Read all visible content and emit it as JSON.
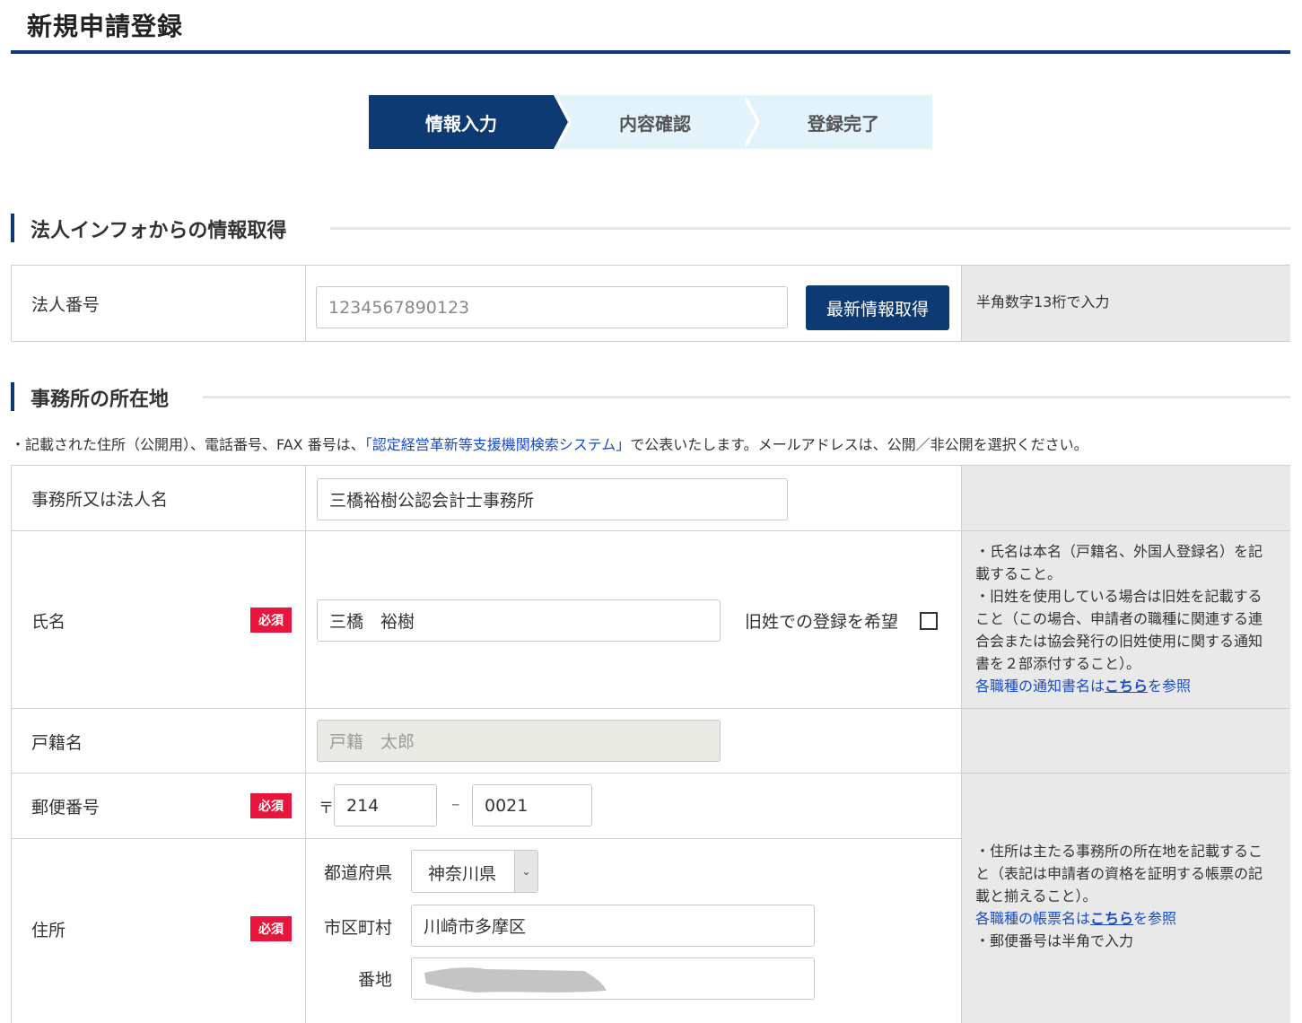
{
  "page": {
    "title": "新規申請登録"
  },
  "steps": [
    {
      "label": "情報入力",
      "state": "active"
    },
    {
      "label": "内容確認",
      "state": "todo"
    },
    {
      "label": "登録完了",
      "state": "todo"
    }
  ],
  "section_corp": {
    "heading": "法人インフォからの情報取得",
    "corp_number_label": "法人番号",
    "corp_number_placeholder": "1234567890123",
    "fetch_button": "最新情報取得",
    "hint": "半角数字13桁で入力"
  },
  "section_office": {
    "heading": "事務所の所在地",
    "notice_pre": "・記載された住所（公開用）、電話番号、FAX 番号は、",
    "notice_link": "「認定経営革新等支援機関検索システム」",
    "notice_post": "で公表いたします。メールアドレスは、公開／非公開を選択ください。",
    "required_badge": "必須",
    "office_name_label": "事務所又は法人名",
    "office_name_value": "三橋裕樹公認会計士事務所",
    "name_label": "氏名",
    "name_value": "三橋　裕樹",
    "maiden_label": "旧姓での登録を希望",
    "maiden_checked": false,
    "name_hint_lines": [
      "・氏名は本名（戸籍名、外国人登録名）を記",
      "載すること。",
      "・旧姓を使用している場合は旧姓を記載する",
      "こと（この場合、申請者の職種に関連する連",
      "合会または協会発行の旧姓使用に関する通知",
      "書を２部添付すること）。"
    ],
    "name_hint_link_pre": "各職種の通知書名は",
    "name_hint_link_bold": "こちら",
    "name_hint_link_post": "を参照",
    "koseki_label": "戸籍名",
    "koseki_placeholder": "戸籍　太郎",
    "postal_label": "郵便番号",
    "postal_mark": "〒",
    "postal_first": "214",
    "postal_dash": "–",
    "postal_second": "0021",
    "address_label": "住所",
    "pref_label": "都道府県",
    "pref_value": "神奈川県",
    "city_label": "市区町村",
    "city_value": "川崎市多摩区",
    "banchi_label": "番地",
    "address_hint_lines": [
      "・住所は主たる事務所の所在地を記載するこ",
      "と（表記は申請者の資格を証明する帳票の記",
      "載と揃えること）。"
    ],
    "address_hint_link_pre": "各職種の帳票名は",
    "address_hint_link_bold": "こちら",
    "address_hint_link_post": "を参照",
    "address_hint_last": "・郵便番号は半角で入力"
  },
  "colors": {
    "navy": "#0e3a73",
    "required_red": "#e8163c",
    "step_todo": "#e3f3fc",
    "side_gray": "#e9e9e9",
    "link_blue": "#1a4bc8"
  }
}
